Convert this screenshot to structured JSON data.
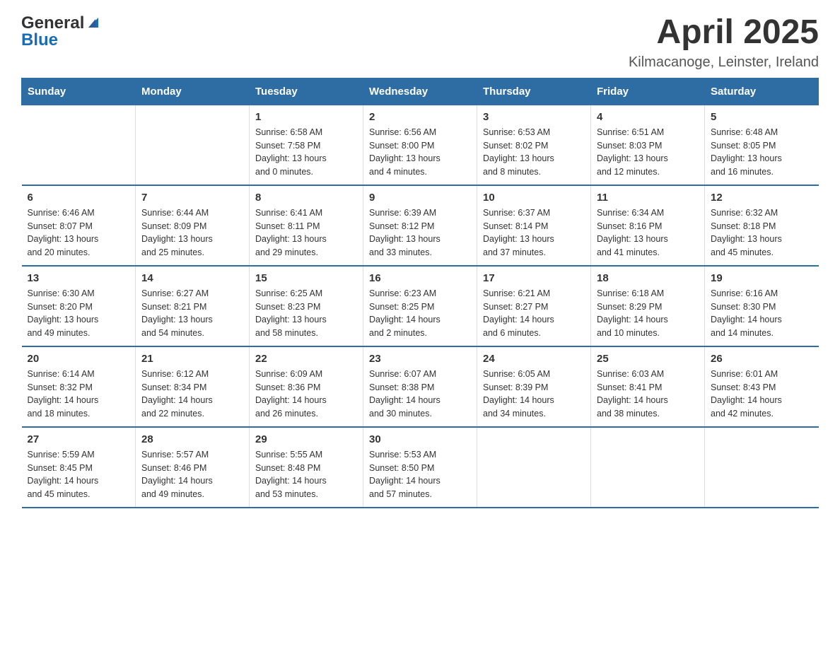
{
  "header": {
    "logo": {
      "general": "General",
      "blue": "Blue"
    },
    "title": "April 2025",
    "subtitle": "Kilmacanoge, Leinster, Ireland"
  },
  "days_of_week": [
    "Sunday",
    "Monday",
    "Tuesday",
    "Wednesday",
    "Thursday",
    "Friday",
    "Saturday"
  ],
  "weeks": [
    [
      {
        "day": "",
        "info": ""
      },
      {
        "day": "",
        "info": ""
      },
      {
        "day": "1",
        "info": "Sunrise: 6:58 AM\nSunset: 7:58 PM\nDaylight: 13 hours\nand 0 minutes."
      },
      {
        "day": "2",
        "info": "Sunrise: 6:56 AM\nSunset: 8:00 PM\nDaylight: 13 hours\nand 4 minutes."
      },
      {
        "day": "3",
        "info": "Sunrise: 6:53 AM\nSunset: 8:02 PM\nDaylight: 13 hours\nand 8 minutes."
      },
      {
        "day": "4",
        "info": "Sunrise: 6:51 AM\nSunset: 8:03 PM\nDaylight: 13 hours\nand 12 minutes."
      },
      {
        "day": "5",
        "info": "Sunrise: 6:48 AM\nSunset: 8:05 PM\nDaylight: 13 hours\nand 16 minutes."
      }
    ],
    [
      {
        "day": "6",
        "info": "Sunrise: 6:46 AM\nSunset: 8:07 PM\nDaylight: 13 hours\nand 20 minutes."
      },
      {
        "day": "7",
        "info": "Sunrise: 6:44 AM\nSunset: 8:09 PM\nDaylight: 13 hours\nand 25 minutes."
      },
      {
        "day": "8",
        "info": "Sunrise: 6:41 AM\nSunset: 8:11 PM\nDaylight: 13 hours\nand 29 minutes."
      },
      {
        "day": "9",
        "info": "Sunrise: 6:39 AM\nSunset: 8:12 PM\nDaylight: 13 hours\nand 33 minutes."
      },
      {
        "day": "10",
        "info": "Sunrise: 6:37 AM\nSunset: 8:14 PM\nDaylight: 13 hours\nand 37 minutes."
      },
      {
        "day": "11",
        "info": "Sunrise: 6:34 AM\nSunset: 8:16 PM\nDaylight: 13 hours\nand 41 minutes."
      },
      {
        "day": "12",
        "info": "Sunrise: 6:32 AM\nSunset: 8:18 PM\nDaylight: 13 hours\nand 45 minutes."
      }
    ],
    [
      {
        "day": "13",
        "info": "Sunrise: 6:30 AM\nSunset: 8:20 PM\nDaylight: 13 hours\nand 49 minutes."
      },
      {
        "day": "14",
        "info": "Sunrise: 6:27 AM\nSunset: 8:21 PM\nDaylight: 13 hours\nand 54 minutes."
      },
      {
        "day": "15",
        "info": "Sunrise: 6:25 AM\nSunset: 8:23 PM\nDaylight: 13 hours\nand 58 minutes."
      },
      {
        "day": "16",
        "info": "Sunrise: 6:23 AM\nSunset: 8:25 PM\nDaylight: 14 hours\nand 2 minutes."
      },
      {
        "day": "17",
        "info": "Sunrise: 6:21 AM\nSunset: 8:27 PM\nDaylight: 14 hours\nand 6 minutes."
      },
      {
        "day": "18",
        "info": "Sunrise: 6:18 AM\nSunset: 8:29 PM\nDaylight: 14 hours\nand 10 minutes."
      },
      {
        "day": "19",
        "info": "Sunrise: 6:16 AM\nSunset: 8:30 PM\nDaylight: 14 hours\nand 14 minutes."
      }
    ],
    [
      {
        "day": "20",
        "info": "Sunrise: 6:14 AM\nSunset: 8:32 PM\nDaylight: 14 hours\nand 18 minutes."
      },
      {
        "day": "21",
        "info": "Sunrise: 6:12 AM\nSunset: 8:34 PM\nDaylight: 14 hours\nand 22 minutes."
      },
      {
        "day": "22",
        "info": "Sunrise: 6:09 AM\nSunset: 8:36 PM\nDaylight: 14 hours\nand 26 minutes."
      },
      {
        "day": "23",
        "info": "Sunrise: 6:07 AM\nSunset: 8:38 PM\nDaylight: 14 hours\nand 30 minutes."
      },
      {
        "day": "24",
        "info": "Sunrise: 6:05 AM\nSunset: 8:39 PM\nDaylight: 14 hours\nand 34 minutes."
      },
      {
        "day": "25",
        "info": "Sunrise: 6:03 AM\nSunset: 8:41 PM\nDaylight: 14 hours\nand 38 minutes."
      },
      {
        "day": "26",
        "info": "Sunrise: 6:01 AM\nSunset: 8:43 PM\nDaylight: 14 hours\nand 42 minutes."
      }
    ],
    [
      {
        "day": "27",
        "info": "Sunrise: 5:59 AM\nSunset: 8:45 PM\nDaylight: 14 hours\nand 45 minutes."
      },
      {
        "day": "28",
        "info": "Sunrise: 5:57 AM\nSunset: 8:46 PM\nDaylight: 14 hours\nand 49 minutes."
      },
      {
        "day": "29",
        "info": "Sunrise: 5:55 AM\nSunset: 8:48 PM\nDaylight: 14 hours\nand 53 minutes."
      },
      {
        "day": "30",
        "info": "Sunrise: 5:53 AM\nSunset: 8:50 PM\nDaylight: 14 hours\nand 57 minutes."
      },
      {
        "day": "",
        "info": ""
      },
      {
        "day": "",
        "info": ""
      },
      {
        "day": "",
        "info": ""
      }
    ]
  ]
}
